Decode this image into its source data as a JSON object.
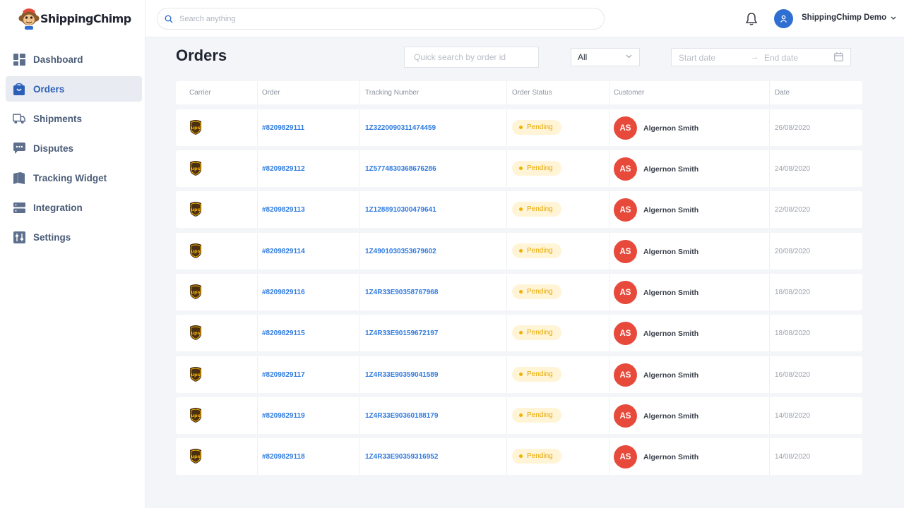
{
  "app": {
    "name": "ShippingChimp"
  },
  "sidebar": {
    "items": [
      {
        "label": "Dashboard",
        "icon": "dashboard-icon",
        "active": false
      },
      {
        "label": "Orders",
        "icon": "bag-icon",
        "active": true
      },
      {
        "label": "Shipments",
        "icon": "truck-icon",
        "active": false
      },
      {
        "label": "Disputes",
        "icon": "chat-icon",
        "active": false
      },
      {
        "label": "Tracking Widget",
        "icon": "widget-icon",
        "active": false
      },
      {
        "label": "Integration",
        "icon": "server-icon",
        "active": false
      },
      {
        "label": "Settings",
        "icon": "sliders-icon",
        "active": false
      }
    ]
  },
  "header": {
    "search_placeholder": "Search anything",
    "user_name": "ShippingChimp Demo"
  },
  "page": {
    "title": "Orders",
    "quick_search_placeholder": "Quick search by order id",
    "status_filter": "All",
    "start_date_placeholder": "Start date",
    "end_date_placeholder": "End date"
  },
  "table": {
    "columns": [
      "Carrier",
      "Order",
      "Tracking Number",
      "Order Status",
      "Customer",
      "Date"
    ],
    "rows": [
      {
        "carrier": "ups",
        "order": "#8209829111",
        "tracking": "1Z3220090311474459",
        "status": "Pending",
        "initials": "AS",
        "customer": "Algernon Smith",
        "date": "26/08/2020"
      },
      {
        "carrier": "ups",
        "order": "#8209829112",
        "tracking": "1Z5774830368676286",
        "status": "Pending",
        "initials": "AS",
        "customer": "Algernon Smith",
        "date": "24/08/2020"
      },
      {
        "carrier": "ups",
        "order": "#8209829113",
        "tracking": "1Z1288910300479641",
        "status": "Pending",
        "initials": "AS",
        "customer": "Algernon Smith",
        "date": "22/08/2020"
      },
      {
        "carrier": "ups",
        "order": "#8209829114",
        "tracking": "1Z4901030353679602",
        "status": "Pending",
        "initials": "AS",
        "customer": "Algernon Smith",
        "date": "20/08/2020"
      },
      {
        "carrier": "ups",
        "order": "#8209829116",
        "tracking": "1Z4R33E90358767968",
        "status": "Pending",
        "initials": "AS",
        "customer": "Algernon Smith",
        "date": "18/08/2020"
      },
      {
        "carrier": "ups",
        "order": "#8209829115",
        "tracking": "1Z4R33E90159672197",
        "status": "Pending",
        "initials": "AS",
        "customer": "Algernon Smith",
        "date": "18/08/2020"
      },
      {
        "carrier": "ups",
        "order": "#8209829117",
        "tracking": "1Z4R33E90359041589",
        "status": "Pending",
        "initials": "AS",
        "customer": "Algernon Smith",
        "date": "16/08/2020"
      },
      {
        "carrier": "ups",
        "order": "#8209829119",
        "tracking": "1Z4R33E90360188179",
        "status": "Pending",
        "initials": "AS",
        "customer": "Algernon Smith",
        "date": "14/08/2020"
      },
      {
        "carrier": "ups",
        "order": "#8209829118",
        "tracking": "1Z4R33E90359316952",
        "status": "Pending",
        "initials": "AS",
        "customer": "Algernon Smith",
        "date": "14/08/2020"
      }
    ]
  },
  "colors": {
    "accent": "#2c5fb8",
    "link": "#2f7be0",
    "pending_bg": "#fff4d6",
    "pending_text": "#e8a800",
    "avatar": "#e74a3b",
    "ups_brown": "#4a2f12",
    "ups_gold": "#f5b400"
  }
}
